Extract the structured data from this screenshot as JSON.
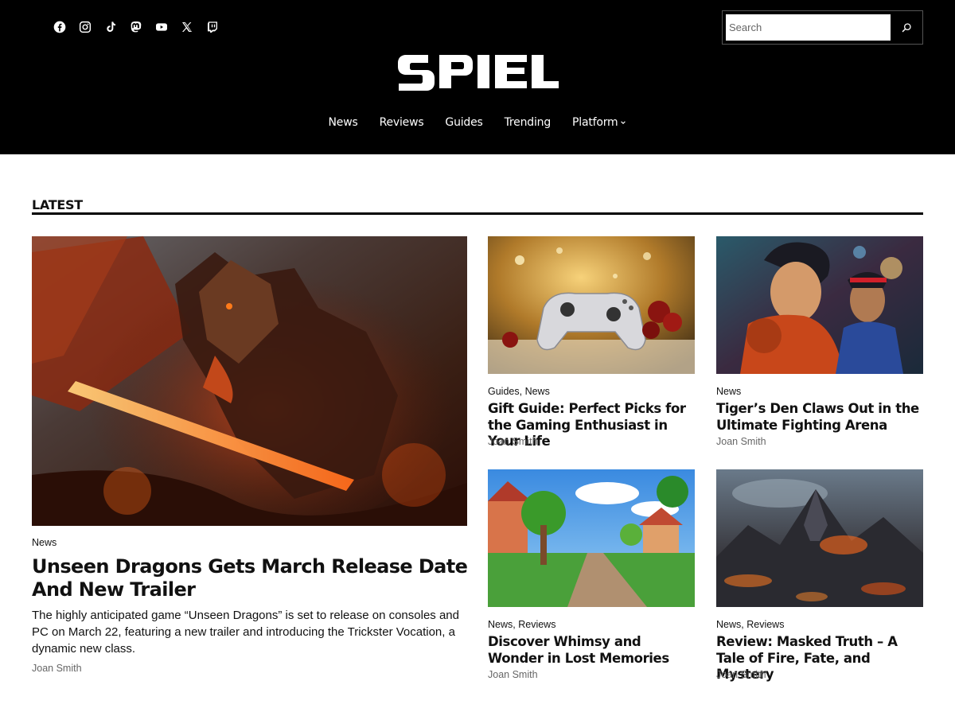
{
  "header": {
    "social": [
      "facebook-icon",
      "instagram-icon",
      "tiktok-icon",
      "mastodon-icon",
      "youtube-icon",
      "x-icon",
      "twitch-icon"
    ],
    "search": {
      "placeholder": "Search",
      "value": ""
    },
    "logo_text": "SPIEL",
    "nav": [
      {
        "label": "News"
      },
      {
        "label": "Reviews"
      },
      {
        "label": "Guides"
      },
      {
        "label": "Trending"
      },
      {
        "label": "Platform",
        "has_dropdown": true
      }
    ]
  },
  "section": {
    "title": "LATEST"
  },
  "featured": {
    "category": "News",
    "title": "Unseen Dragons Gets March Release Date And New Trailer",
    "excerpt": "The highly anticipated game “Unseen Dragons” is set to release on consoles and PC on March 22, featuring a new trailer and introducing the Trickster Vocation, a dynamic new class.",
    "author": "Joan Smith"
  },
  "posts": [
    {
      "categories": [
        "Guides",
        "News"
      ],
      "title": "Gift Guide: Perfect Picks for the Gaming Enthusiast in Your Life",
      "author": "Joan Smith"
    },
    {
      "categories": [
        "News"
      ],
      "title": "Tiger’s Den Claws Out in the Ultimate Fighting Arena",
      "author": "Joan Smith"
    },
    {
      "categories": [
        "News",
        "Reviews"
      ],
      "title": "Discover Whimsy and Wonder in Lost Memories",
      "author": "Joan Smith"
    },
    {
      "categories": [
        "News",
        "Reviews"
      ],
      "title": "Review: Masked Truth – A Tale of Fire, Fate, and Mystery",
      "author": "Joan Smith"
    }
  ],
  "colors": {
    "header_bg": "#000000",
    "text": "#111111",
    "muted": "#666666"
  }
}
